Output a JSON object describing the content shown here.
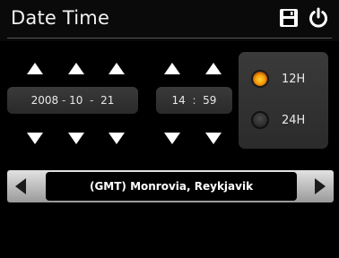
{
  "window": {
    "title": "Date Time"
  },
  "header": {
    "save_icon": "save-icon",
    "power_icon": "power-icon"
  },
  "date": {
    "year": "2008",
    "month": "10",
    "day": "21",
    "separator": "-"
  },
  "time": {
    "hour": "14",
    "minute": "59",
    "separator": ":"
  },
  "format": {
    "options": [
      {
        "label": "12H",
        "selected": true
      },
      {
        "label": "24H",
        "selected": false
      }
    ]
  },
  "timezone": {
    "value": "(GMT) Monrovia, Reykjavik"
  },
  "colors": {
    "selected_radio": "#f59b0b",
    "background": "#000000",
    "panel": "#333333"
  }
}
